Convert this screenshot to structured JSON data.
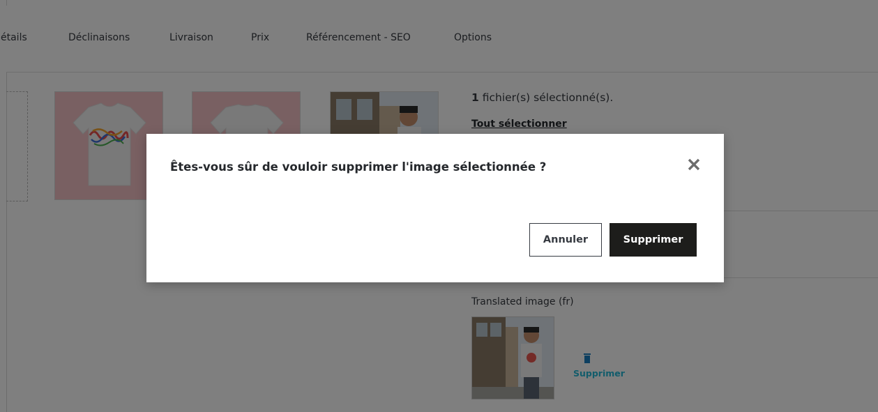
{
  "tabs": [
    "étails",
    "Déclinaisons",
    "Livraison",
    "Prix",
    "Référencement - SEO",
    "Options"
  ],
  "selection": {
    "count": "1",
    "text": " fichier(s) sélectionné(s).",
    "select_all": "Tout sélectionner"
  },
  "translated": {
    "label": "Translated image (fr)",
    "delete_label": "Supprimer"
  },
  "modal": {
    "title": "Êtes-vous sûr de vouloir supprimer l'image sélectionnée ?",
    "cancel_label": "Annuler",
    "confirm_label": "Supprimer"
  },
  "icons": [
    "close-icon",
    "trash-icon"
  ],
  "thumbnails": [
    "tshirt-bonjour",
    "tshirt-back",
    "person-photo"
  ],
  "colors": {
    "overlay": "rgba(0,0,0,0.5)",
    "primary_button": "#1d1d1b",
    "link": "#25b9d7",
    "thumb_background": "#f2c0c4"
  }
}
